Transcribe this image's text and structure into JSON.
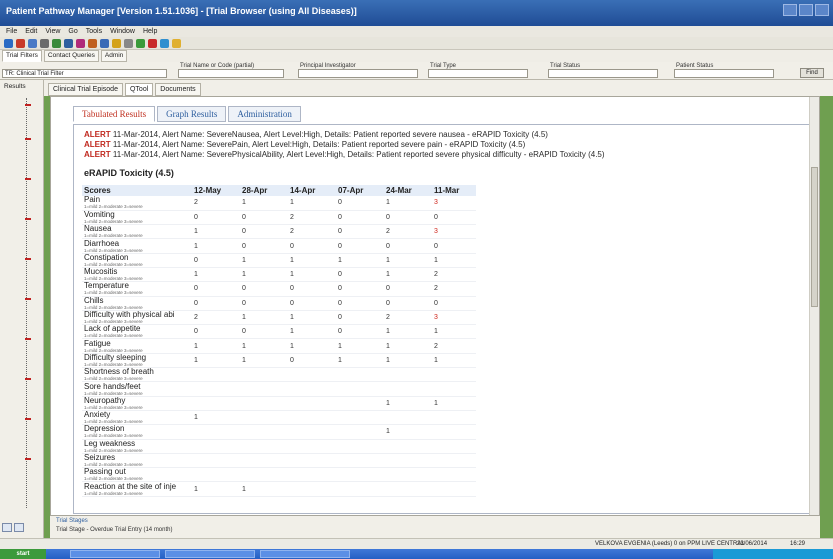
{
  "window": {
    "title": "Patient Pathway Manager [Version 1.51.1036] - [Trial Browser (using All Diseases)]"
  },
  "menu": [
    "File",
    "Edit",
    "View",
    "Go",
    "Tools",
    "Window",
    "Help"
  ],
  "filter_tabs": [
    "Trial Filters",
    "Contact Queries",
    "Admin"
  ],
  "filter_row": {
    "trial_filter_value": "TR: Clinical Trial Filter",
    "labels": [
      "Trial Name or Code (partial)",
      "Principal Investigator",
      "Trial Type",
      "Trial Status",
      "Patient Status"
    ],
    "find_button": "Find"
  },
  "left_pane": {
    "label": "Results"
  },
  "main_tabs": [
    "Clinical Trial Episode",
    "QTool",
    "Documents"
  ],
  "sub_tabs": [
    "Tabulated Results",
    "Graph Results",
    "Administration"
  ],
  "alerts": [
    {
      "tag": "ALERT",
      "text": "11-Mar-2014, Alert Name: SevereNausea, Alert Level:High, Details: Patient reported severe nausea - eRAPID Toxicity (4.5)"
    },
    {
      "tag": "ALERT",
      "text": "11-Mar-2014, Alert Name: SeverePain, Alert Level:High, Details: Patient reported severe pain - eRAPID Toxicity (4.5)"
    },
    {
      "tag": "ALERT",
      "text": "11-Mar-2014, Alert Name: SeverePhysicalAbility, Alert Level:High, Details: Patient reported severe physical difficulty - eRAPID Toxicity (4.5)"
    }
  ],
  "section_title": "eRAPID Toxicity (4.5)",
  "table": {
    "header": "Scores",
    "dates": [
      "12-May",
      "28-Apr",
      "14-Apr",
      "07-Apr",
      "24-Mar",
      "11-Mar"
    ],
    "sub_label": "1=mild 2=moderate 3=severe",
    "rows": [
      {
        "name": "Pain",
        "values": [
          "2",
          "1",
          "1",
          "0",
          "1",
          "3"
        ]
      },
      {
        "name": "Vomiting",
        "values": [
          "0",
          "0",
          "2",
          "0",
          "0",
          "0"
        ]
      },
      {
        "name": "Nausea",
        "values": [
          "1",
          "0",
          "2",
          "0",
          "2",
          "3"
        ]
      },
      {
        "name": "Diarrhoea",
        "values": [
          "1",
          "0",
          "0",
          "0",
          "0",
          "0"
        ]
      },
      {
        "name": "Constipation",
        "values": [
          "0",
          "1",
          "1",
          "1",
          "1",
          "1"
        ]
      },
      {
        "name": "Mucositis",
        "values": [
          "1",
          "1",
          "1",
          "0",
          "1",
          "2"
        ]
      },
      {
        "name": "Temperature",
        "values": [
          "0",
          "0",
          "0",
          "0",
          "0",
          "2"
        ]
      },
      {
        "name": "Chills",
        "values": [
          "0",
          "0",
          "0",
          "0",
          "0",
          "0"
        ]
      },
      {
        "name": "Difficulty with physical abi",
        "values": [
          "2",
          "1",
          "1",
          "0",
          "2",
          "3"
        ]
      },
      {
        "name": "Lack of appetite",
        "values": [
          "0",
          "0",
          "1",
          "0",
          "1",
          "1"
        ]
      },
      {
        "name": "Fatigue",
        "values": [
          "1",
          "1",
          "1",
          "1",
          "1",
          "2"
        ]
      },
      {
        "name": "Difficulty sleeping",
        "values": [
          "1",
          "1",
          "0",
          "1",
          "1",
          "1"
        ]
      },
      {
        "name": "Shortness of breath",
        "values": [
          "",
          "",
          "",
          "",
          "",
          ""
        ]
      },
      {
        "name": "Sore hands/feet",
        "values": [
          "",
          "",
          "",
          "",
          "",
          ""
        ]
      },
      {
        "name": "Neuropathy",
        "values": [
          "",
          "",
          "",
          "",
          "1",
          "1"
        ]
      },
      {
        "name": "Anxiety",
        "values": [
          "1",
          "",
          "",
          "",
          "",
          ""
        ]
      },
      {
        "name": "Depression",
        "values": [
          "",
          "",
          "",
          "",
          "1",
          ""
        ]
      },
      {
        "name": "Leg weakness",
        "values": [
          "",
          "",
          "",
          "",
          "",
          ""
        ]
      },
      {
        "name": "Seizures",
        "values": [
          "",
          "",
          "",
          "",
          "",
          ""
        ]
      },
      {
        "name": "Passing out",
        "values": [
          "",
          "",
          "",
          "",
          "",
          ""
        ]
      },
      {
        "name": "Reaction at the site of inje",
        "values": [
          "1",
          "1",
          "",
          "",
          "",
          ""
        ]
      }
    ]
  },
  "status_area": {
    "group": "Trial Stages",
    "entry": "Trial Stage - Overdue Trial Entry (14 month)"
  },
  "status_bar": {
    "left": "VELKOVA EVGENIA (Leeds) 0 on PPM LIVE CENTRAL",
    "date": "23/06/2014",
    "time": "16:29"
  },
  "taskbar": {
    "start_label": "start"
  },
  "colors": {
    "alert_red": "#c0281e",
    "titlebar_blue": "#1f4c95",
    "tab_blue": "#2f5f9f"
  }
}
